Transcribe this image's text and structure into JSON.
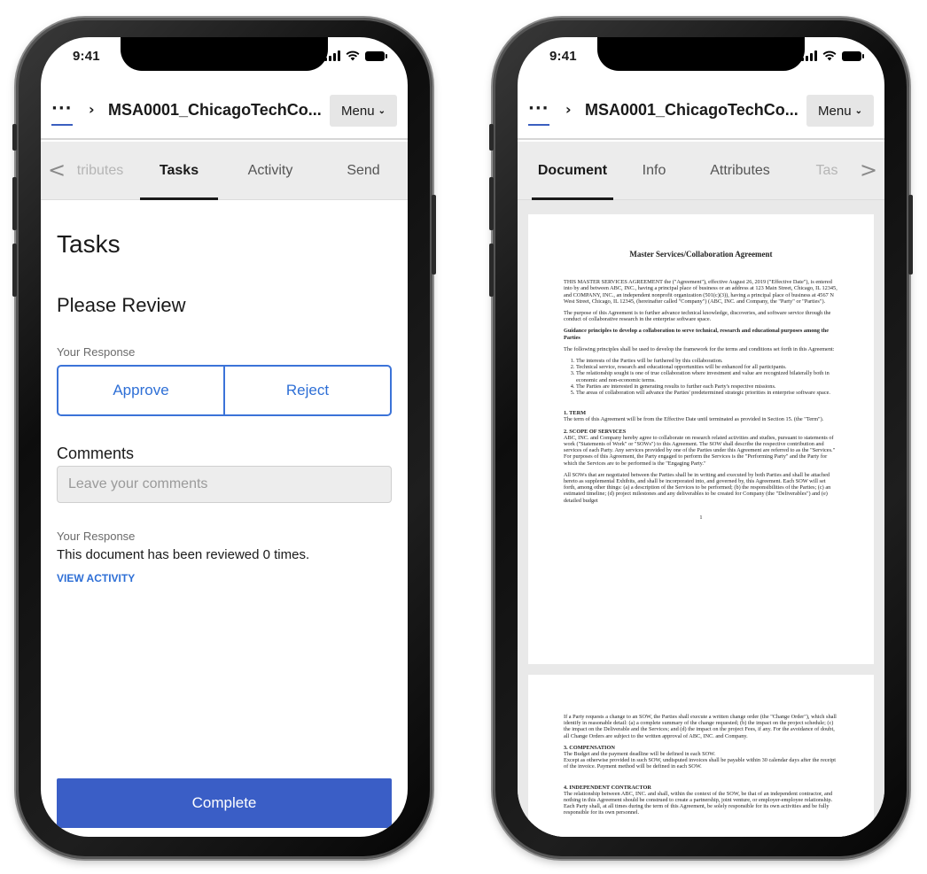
{
  "left_phone": {
    "status_time": "9:41",
    "header": {
      "more": "···",
      "doc_title": "MSA0001_ChicagoTechCo...",
      "menu_label": "Menu"
    },
    "tabs": [
      "tributes",
      "Tasks",
      "Activity",
      "Send"
    ],
    "active_tab": "Tasks",
    "tasks": {
      "heading": "Tasks",
      "task_title": "Please Review",
      "response_label": "Your Response",
      "approve_label": "Approve",
      "reject_label": "Reject",
      "comments_label": "Comments",
      "comments_placeholder": "Leave your comments",
      "response_label_2": "Your Response",
      "reviewed_text": "This document has been reviewed 0 times.",
      "view_activity": "VIEW ACTIVITY",
      "complete_label": "Complete"
    }
  },
  "right_phone": {
    "status_time": "9:41",
    "header": {
      "more": "···",
      "doc_title": "MSA0001_ChicagoTechCo...",
      "menu_label": "Menu"
    },
    "tabs": [
      "Document",
      "Info",
      "Attributes",
      "Tas"
    ],
    "active_tab": "Document",
    "document": {
      "title": "Master Services/Collaboration Agreement",
      "p1": "THIS MASTER SERVICES AGREEMENT the (\"Agreement\"), effective August 26, 2019 (\"Effective Date\"), is entered into by and between ABC, INC., having a principal place of business or an address at 123 Main Street, Chicago, IL 12345, and COMPANY, INC., an independent nonprofit organization (501(c)(3)), having a principal place of business at 4567 N West Street, Chicago, IL 12345, (hereinafter called \"Company\") (ABC, INC. and Company, the \"Party\" or \"Parties\").",
      "p2": "The purpose of this Agreement is to further advance technical knowledge, discoveries, and software service through the conduct of collaborative research in the enterprise software space.",
      "p3": "Guidance principles to develop a collaboration to serve technical, research and educational purposes among the Parties",
      "p4": "The following principles shall be used to develop the framework for the terms and conditions set forth in this Agreement:",
      "list": [
        "The interests of the Parties will be furthered by this collaboration.",
        "Technical service, research and educational opportunities will be enhanced for all participants.",
        "The relationship sought is one of true collaboration where investment and value are recognized bilaterally both in economic and non-economic terms.",
        "The Parties are interested in generating results to further each Party's respective missions.",
        "The areas of collaboration will advance the Parties' predetermined strategic priorities in enterprise software space."
      ],
      "s1_head": "1.        TERM",
      "s1_body": "The term of this Agreement will be from the Effective Date until terminated as provided in Section 15. (the \"Term\").",
      "s2_head": "2.        SCOPE OF SERVICES",
      "s2_body": "ABC, INC. and Company hereby agree to collaborate on research related activities and studies, pursuant to statements of work (\"Statements of Work\" or \"SOWs\") to this Agreement. The SOW shall describe the respective contribution and services of each Party. Any services provided by one of the Parties under this Agreement are referred to as the \"Services.\" For purposes of this Agreement, the Party engaged to perform the Services is the \"Performing Party\" and the Party for which the Services are to be performed is the \"Engaging Party.\"",
      "s2_body2": "All SOWs that are negotiated between the Parties shall be in writing and executed by both Parties and shall be attached hereto as supplemental Exhibits, and shall be incorporated into, and governed by, this Agreement. Each SOW will set forth, among other things: (a) a description of the Services to be performed; (b) the responsibilities of the Parties; (c) an estimated timeline; (d) project milestones and any deliverables to be created for Company (the \"Deliverables\") and (e) detailed budget",
      "page_num": "1",
      "p2_change": "If a Party requests a change to an SOW, the Parties shall execute a written change order (the \"Change Order\"), which shall identify in reasonable detail: (a) a complete summary of the change requested; (b) the impact on the project schedule; (c) the impact on the Deliverable and the Services; and (d) the impact on the project Fees, if any. For the avoidance of doubt, all Change Orders are subject to the written approval of ABC, INC. and Company.",
      "s3_head": "3.        COMPENSATION",
      "s3_body": "The Budget and the payment deadline will be defined in each SOW.",
      "s3_body2": "Except as otherwise provided in such SOW, undisputed invoices shall be payable within 30 calendar days after the receipt of the invoice. Payment method will be defined in each SOW.",
      "s4_head": "4.        INDEPENDENT CONTRACTOR",
      "s4_body": "The relationship between ABC, INC. and shall, within the context of the SOW, be that of an independent contractor, and nothing in this Agreement should be construed to create a partnership, joint venture, or employer-employee relationship. Each Party shall, at all times during the term of this Agreement, be solely responsible for its own activities and be fully responsible for its own personnel."
    }
  },
  "colors": {
    "accent": "#3a5ec6",
    "link": "#2e6fd6",
    "tab_bar": "#ececec"
  }
}
